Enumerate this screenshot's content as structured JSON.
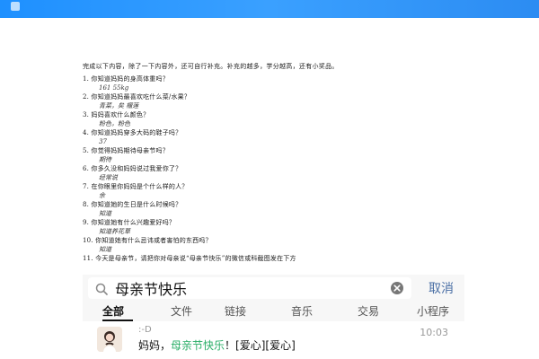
{
  "worksheet": {
    "intro": "完成以下内容，除了一下内容外，还可自行补充。补充的越多，学分越高，还有小奖品。",
    "items": [
      {
        "q": "1.   你知道妈妈的身高体重吗？",
        "a": "161 55kg"
      },
      {
        "q": "2.   你知道妈妈最喜欢吃什么菜/水果？",
        "a": "青菜，矣 榴莲"
      },
      {
        "q": "3.   妈妈喜欢什么颜色？",
        "a": "粉色，粉色"
      },
      {
        "q": "4.   你知道妈妈穿多大码的鞋子吗？",
        "a": "37"
      },
      {
        "q": "5.   你觉得妈妈期待母亲节吗？",
        "a": "期待"
      },
      {
        "q": "6.   你多久没和妈妈说过我爱你了？",
        "a": "经常说"
      },
      {
        "q": "7.   在你眼里你妈妈是个什么样的人？",
        "a": "余"
      },
      {
        "q": "8.   你知道她的生日是什么时候吗？",
        "a": "知道"
      },
      {
        "q": "9.   你知道她有什么兴趣爱好吗？",
        "a": "知道养花草"
      },
      {
        "q": "10.  你知道她有什么忌讳或者害怕的东西吗？",
        "a": "知道"
      },
      {
        "q": "11.  今天是母亲节，请把你对母亲说“母亲节快乐”的微信或科截图发在下方",
        "a": ""
      }
    ]
  },
  "search": {
    "query": "母亲节快乐",
    "cancel_label": "取消"
  },
  "tabs": {
    "items": [
      "全部",
      "文件",
      "链接",
      "音乐",
      "交易",
      "小程序"
    ],
    "active_index": 0
  },
  "result": {
    "sender": ":-D",
    "time": "10:03",
    "message_prefix": "妈妈，",
    "message_highlight": "母亲节快乐",
    "message_suffix": "！[爱心][爱心]"
  },
  "colors": {
    "topbar": "#1e90ff",
    "highlight": "#2aae67",
    "cancel": "#4a6fa5"
  },
  "icons": {
    "search": "search-icon",
    "clear": "clear-icon",
    "avatar": "avatar"
  }
}
